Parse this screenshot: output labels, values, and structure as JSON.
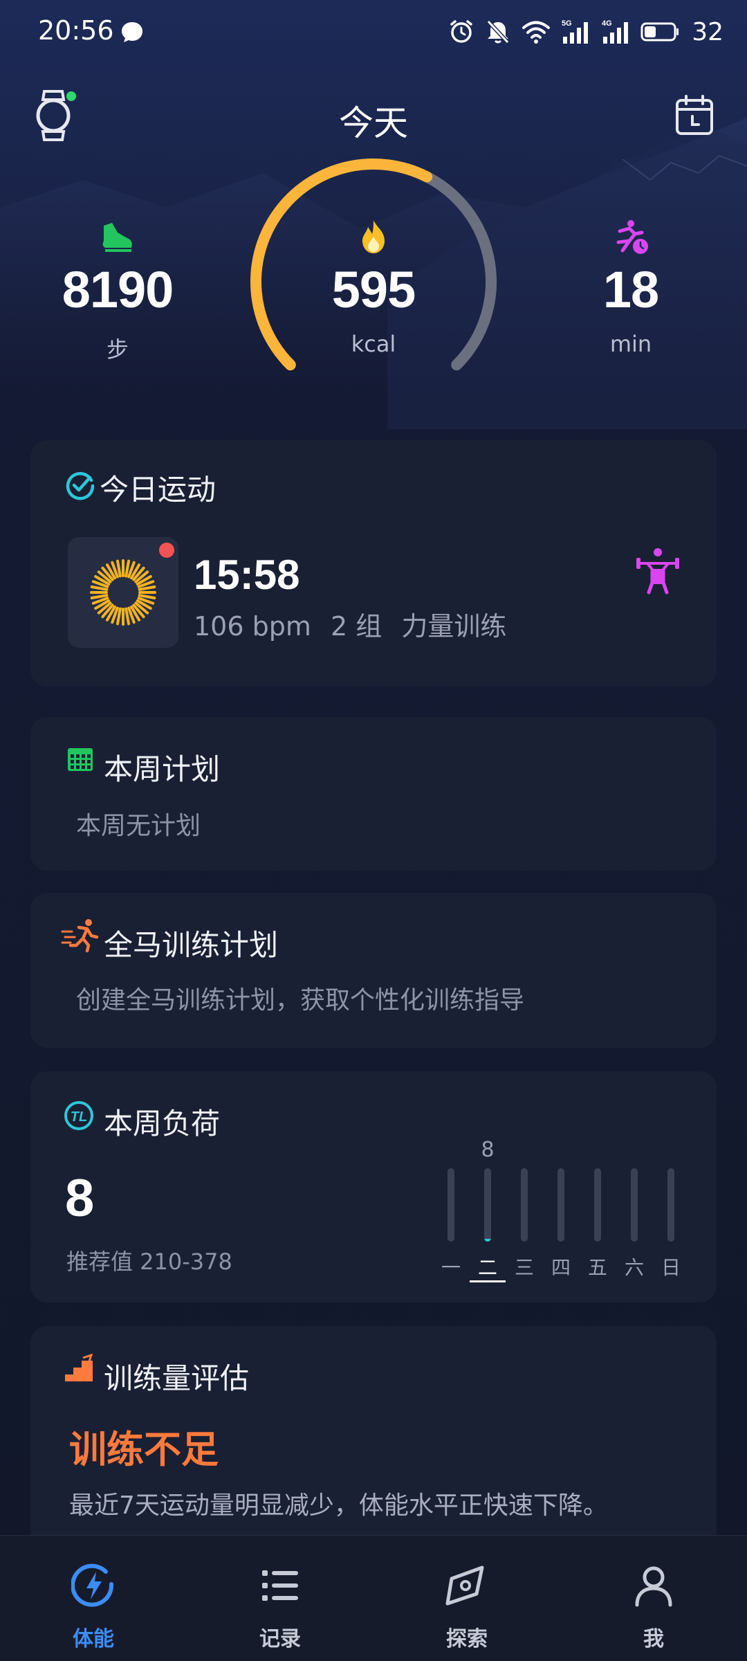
{
  "status_bar": {
    "time": "20:56",
    "battery_percent": "32",
    "network_labels": [
      "5G",
      "4G"
    ]
  },
  "header": {
    "title": "今天"
  },
  "today_stats": {
    "steps": {
      "value": "8190",
      "unit": "步",
      "icon": "shoe-icon",
      "color": "#22c55e"
    },
    "calories": {
      "value": "595",
      "unit": "kcal",
      "icon": "flame-icon",
      "color": "#fbbf24"
    },
    "active_minutes": {
      "value": "18",
      "unit": "min",
      "icon": "running-clock-icon",
      "color": "#d946ef"
    },
    "ring": {
      "progress_fraction": 0.6,
      "fill_color": "#fbb53a",
      "track_color": "#6b7080"
    }
  },
  "today_workout": {
    "title": "今日运动",
    "time": "15:58",
    "heart_rate": "106 bpm",
    "sets": "2 组",
    "type": "力量训练",
    "icon": "weightlifting-icon"
  },
  "weekly_plan": {
    "title": "本周计划",
    "subtitle": "本周无计划"
  },
  "marathon_plan": {
    "title": "全马训练计划",
    "subtitle": "创建全马训练计划，获取个性化训练指导"
  },
  "weekly_load": {
    "title": "本周负荷",
    "value": "8",
    "recommended": "推荐值 210-378",
    "days": [
      {
        "label": "一",
        "value": 0
      },
      {
        "label": "二",
        "value": 8,
        "value_label": "8",
        "active": true
      },
      {
        "label": "三",
        "value": 0
      },
      {
        "label": "四",
        "value": 0
      },
      {
        "label": "五",
        "value": 0
      },
      {
        "label": "六",
        "value": 0
      },
      {
        "label": "日",
        "value": 0
      }
    ],
    "scale_max": 210,
    "accent_color": "#2ec7d8"
  },
  "training_assessment": {
    "title": "训练量评估",
    "status": "训练不足",
    "description": "最近7天运动量明显减少，体能水平正快速下降。",
    "status_color": "#ff7a3d"
  },
  "bottom_nav": {
    "items": [
      {
        "label": "体能",
        "icon": "bolt-circle-icon",
        "active": true
      },
      {
        "label": "记录",
        "icon": "list-icon",
        "active": false
      },
      {
        "label": "探索",
        "icon": "compass-icon",
        "active": false
      },
      {
        "label": "我",
        "icon": "person-icon",
        "active": false
      }
    ],
    "active_color": "#3d8cf5"
  }
}
